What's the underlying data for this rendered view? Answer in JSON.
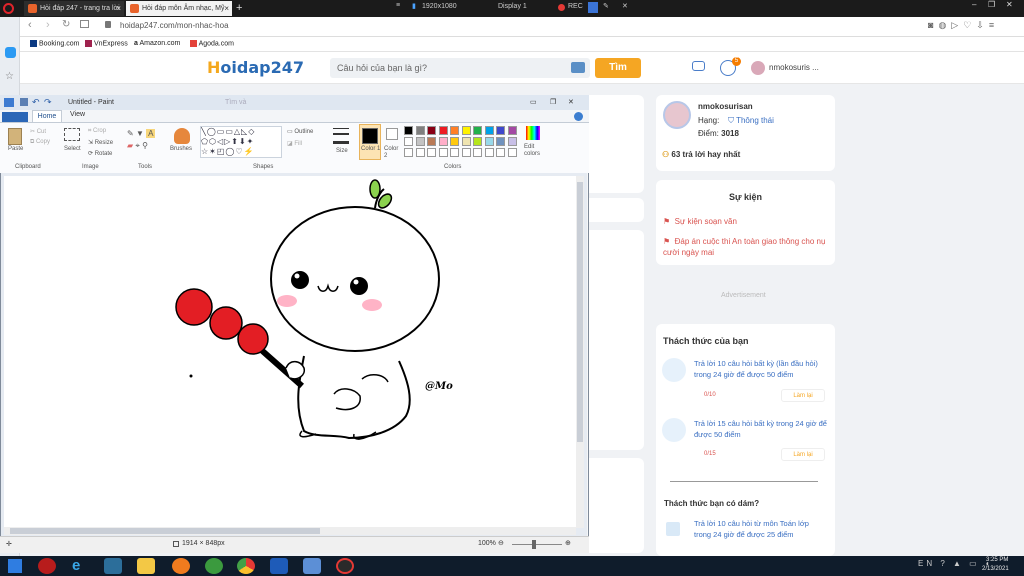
{
  "browser": {
    "tabs": [
      {
        "label": "Hỏi đáp 247 - trang tra lời"
      },
      {
        "label": "Hỏi đáp môn Âm nhạc, Mỹ"
      }
    ],
    "window_info": "1920x1080",
    "display": "Display 1",
    "rec": "REC",
    "url": "hoidap247.com/mon-nhac-hoa",
    "bookmarks": [
      "Booking.com",
      "VnExpress",
      "Amazon.com",
      "Agoda.com"
    ]
  },
  "site": {
    "logo": "Hoidap247",
    "logo_first": "H",
    "logo_rest": "oidap247",
    "search_placeholder": "Câu hỏi của bạn là gì?",
    "search_button": "Tìm",
    "notif_count": "5",
    "username_short": "nmokosuris ..."
  },
  "paint": {
    "title": "Untitled - Paint",
    "title_hint": "Tìm và",
    "tabs": [
      "Home",
      "View"
    ],
    "groups": [
      "Clipboard",
      "Image",
      "Tools",
      "Shapes",
      "Colors"
    ],
    "clipboard": {
      "paste": "Paste",
      "cut": "Cut",
      "copy": "Copy"
    },
    "image": {
      "select": "Select",
      "crop": "Crop",
      "resize": "Resize",
      "rotate": "Rotate"
    },
    "brushes": "Brushes",
    "outline": "Outline",
    "fill": "Fill",
    "size": "Size",
    "color1": "Color 1",
    "color2": "Color 2",
    "edit_colors": "Edit colors",
    "signature": "@Mo",
    "status_size": "1914 × 848px",
    "zoom": "100%",
    "palette_row1": [
      "#000000",
      "#7f7f7f",
      "#880015",
      "#ed1c24",
      "#ff7f27",
      "#fff200",
      "#22b14c",
      "#00a2e8",
      "#3f48cc",
      "#a349a4"
    ],
    "palette_row2": [
      "#ffffff",
      "#c3c3c3",
      "#b97a57",
      "#ffaec9",
      "#ffc90e",
      "#efe4b0",
      "#b5e61d",
      "#99d9ea",
      "#7092be",
      "#c8bfe7"
    ]
  },
  "profile": {
    "name": "nmokosurisan",
    "rank_label": "Hạng:",
    "rank_value": "Thông thái",
    "points_label": "Điểm:",
    "points_value": "3018",
    "best_answers": "63 trả lời hay nhất"
  },
  "events": {
    "title": "Sự kiện",
    "items": [
      "Sự kiện soạn văn",
      "Đáp án cuộc thi An toàn giao thông cho nụ cười ngày mai"
    ]
  },
  "advertisement": "Advertisement",
  "challenges": {
    "title": "Thách thức của bạn",
    "items": [
      {
        "text": "Trả lời 10 câu hỏi bất kỳ (lần đầu hỏi) trong 24 giờ để được 50 điểm",
        "progress": "0/10",
        "action": "Làm lại"
      },
      {
        "text": "Trả lời 15 câu hỏi bất kỳ trong 24 giờ để được 50 điểm",
        "progress": "0/15",
        "action": "Làm lại"
      }
    ],
    "dare_title": "Thách thức bạn có dám?",
    "dare_item": "Trả lời 10 câu hỏi từ môn Toán lớp trong 24 giờ để được 25 điểm"
  },
  "taskbar": {
    "time": "3:25 PM",
    "date": "2/13/2021"
  }
}
